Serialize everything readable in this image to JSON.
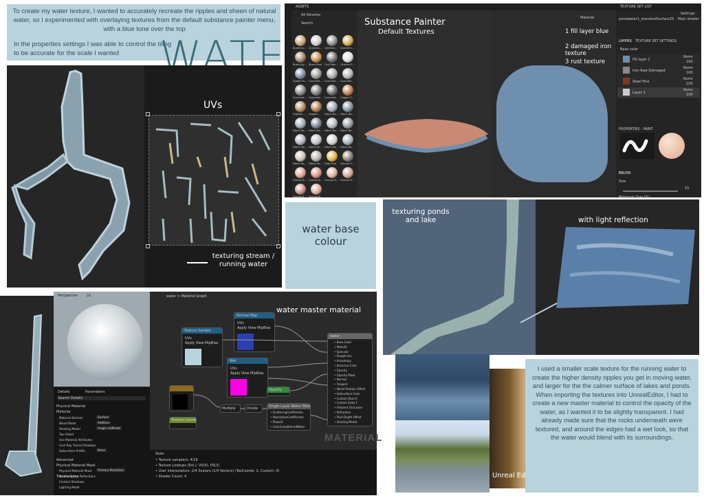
{
  "intro": {
    "line1": "To create my water texture, I wanted to accurately recreate the ripples and sheen of natural water, so I experimented with overlaying textures from the default substance painter menu, with a blue tone over the top",
    "line2": "In the properties settings I was able to control the tiling to be accurate for the scale I wanted"
  },
  "title": "WATER",
  "uvs_label": "UVs",
  "stream_label": "texturing stream / running water",
  "substance": {
    "label_title": "Substance Painter",
    "label_sub": "Default Textures",
    "layer_notes": [
      "1 fill layer blue",
      "2 damaged iron texture",
      "3 rust texture"
    ],
    "assets_header": "ASSETS",
    "all_libraries": "All libraries",
    "search": "Search",
    "texture_set_list": "TEXTURE SET LIST",
    "settings": "Settings",
    "layers_tab": "LAYERS",
    "texture_set_settings_tab": "TEXTURE SET SETTINGS",
    "base_color": "Base color",
    "layers": [
      {
        "name": "Fill layer 1",
        "mode": "Norm",
        "opacity": "100"
      },
      {
        "name": "Iron Raw Damaged",
        "mode": "Norm",
        "opacity": "100"
      },
      {
        "name": "Steel Fine",
        "mode": "Norm",
        "opacity": "100"
      },
      {
        "name": "Layer 1",
        "mode": "Norm",
        "opacity": "100"
      }
    ],
    "properties_paint": "PROPERTIES - PAINT",
    "brush": "BRUSH",
    "size": "Size",
    "size_value": "15",
    "minimum_size": "Minimum Size (%)",
    "material_dropdown": "Material",
    "texture_set_name": "pondwater1_standardSurface2SG1",
    "main_shader": "Main shader",
    "asset_names": [
      "Aluminiu...",
      "Aluminiu...",
      "Artificial...",
      "Autumn L...",
      "Brass Ag...",
      "Brass Pure",
      "Carl Stee...",
      "Chrome S...",
      "Cobalt Pu...",
      "Concrete...",
      "Concrete...",
      "Concrete...",
      "Concrete...",
      "Concrete...",
      "Concrete...",
      "Copper P...",
      "Cookies ...",
      "Copper...",
      "Fabric Ba...",
      "Fabric Ba...",
      "Fabric Ba...",
      "Fabric Ba...",
      "Fabric Ba...",
      "Fabric Ba...",
      "Fabric De...",
      "Fabric Kn...",
      "Fabric Ra...",
      "Fabric Ro...",
      "Fabric So...",
      "Fabric Su...",
      "Gold Pure",
      "Ground S...",
      "Human B...",
      "Human B...",
      "Human B...",
      "Human B...",
      "Human B...",
      "Human B..."
    ]
  },
  "base_colour": "water base colour",
  "ponds_label": "texturing ponds and lake",
  "reflection_label": "with light reflection",
  "master_material": "water master material",
  "material_watermark": "MATERIAL",
  "unreal_label": "Unreal Editor",
  "ue": {
    "graph_tab": "water > Material Graph",
    "perspective": "Perspective",
    "lit": "Lit",
    "details": "Details",
    "parameters": "Parameters",
    "search_details": "Search Details",
    "stats": "Stats",
    "stats_lines": [
      "Texture samplers: 4/16",
      "Texture Lookups (Est.): VS(0), PS(3)",
      "User interpolators: 2/4 Scalars (1/4 Vectors) (TexCoords: 2, Custom: 0)",
      "Shader Count: 4"
    ],
    "detail_sections": [
      "Physical Material",
      "Material"
    ],
    "detail_rows": [
      {
        "label": "Material Domain",
        "value": "Surface"
      },
      {
        "label": "Blend Mode",
        "value": "Additive"
      },
      {
        "label": "Shading Model",
        "value": "Single Lit/Model"
      },
      {
        "label": "Two Sided",
        "value": ""
      },
      {
        "label": "Use Material Attributes",
        "value": ""
      },
      {
        "label": "Cast Ray Traced Shadows",
        "value": ""
      },
      {
        "label": "Subsurface Profile",
        "value": "None"
      }
    ],
    "detail_sections_2": [
      "Advanced",
      "Physical Material Mask",
      "Translucency"
    ],
    "detail_rows_2": [
      {
        "label": "Physical Material Mask",
        "value": "Primary Mask(Sol)"
      },
      {
        "label": "Screen Space Reflections",
        "value": ""
      },
      {
        "label": "Contact Shadows",
        "value": ""
      },
      {
        "label": "Lighting Mode",
        "value": ""
      }
    ],
    "nodes": {
      "texture1": {
        "title": "Texture Sample",
        "sub": "Param2D",
        "rows": [
          "UVs",
          "Apply View MipBias"
        ]
      },
      "normal": {
        "title": "Normal Map",
        "sub": "Param2D",
        "rows": [
          "UVs",
          "Apply View MipBias"
        ]
      },
      "pink": {
        "title": "Wet",
        "sub": "Param2D",
        "rows": [
          "UVs",
          "Apply View MipBias"
        ]
      },
      "opacity": {
        "title": "Opacity",
        "sub": "Param(0.5)"
      },
      "result": {
        "title": "water",
        "pins": [
          "Base Color",
          "Metallic",
          "Specular",
          "Roughness",
          "Anisotropy",
          "Emissive Color",
          "Opacity",
          "Opacity Mask",
          "Normal",
          "Tangent",
          "World Position Offset",
          "Subsurface Color",
          "Custom Data 0",
          "Custom Data 1",
          "Ambient Occlusion",
          "Refraction",
          "Pixel Depth Offset",
          "Shading Model"
        ]
      },
      "multiply": "Multiply",
      "divide": "Divide",
      "lerp": "Single Layer Water Material",
      "lerp_pins": [
        "ScatteringCoefficients",
        "AbsorptionCoefficients",
        "PhaseG",
        "ColorScaleBehindWater"
      ],
      "panner": "Texture Coordinate",
      "rgb": "RGB",
      "rgba": "RGBA"
    }
  },
  "outro": "I used a smaller scale texture for the running water to create the higher density ripples you get in moving water, and larger for the the calmer surface of lakes and ponds. When importing the textures into UnrealEditor, I had to create a new master material to control the opacity of the water, as I wanted it to be slightly transparent. I had already made sure that the rocks underneath were textured, and around the edges had a wet look, so that the water would blend with its surroundings.",
  "colors": {
    "panel_blue": "#b9d3dc",
    "water_blue": "#6f8fae",
    "pink_node": "#ff00e6",
    "wire": "#9a9a9a"
  }
}
